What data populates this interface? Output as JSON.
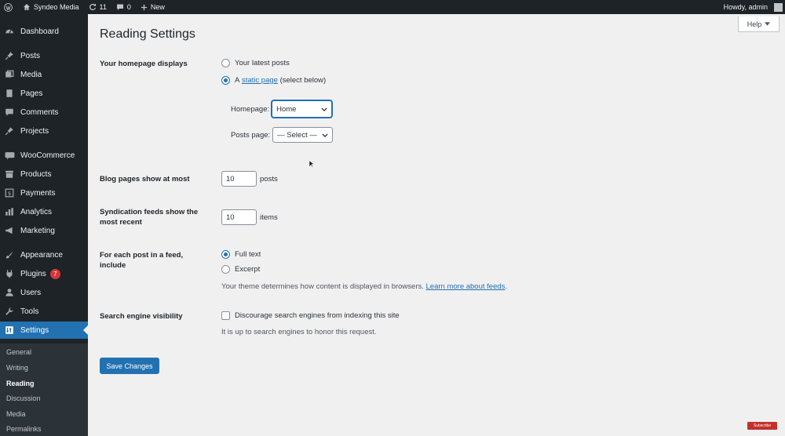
{
  "adminbar": {
    "site_name": "Syndeo Media",
    "updates_count": "11",
    "comments_count": "0",
    "new_label": "New",
    "howdy": "Howdy, admin"
  },
  "sidebar": {
    "items": [
      {
        "label": "Dashboard",
        "icon": "dashboard-icon"
      },
      {
        "label": "Posts",
        "icon": "pin-icon"
      },
      {
        "label": "Media",
        "icon": "media-icon"
      },
      {
        "label": "Pages",
        "icon": "page-icon"
      },
      {
        "label": "Comments",
        "icon": "comment-icon"
      },
      {
        "label": "Projects",
        "icon": "pin-icon"
      },
      {
        "label": "WooCommerce",
        "icon": "woo-icon"
      },
      {
        "label": "Products",
        "icon": "archive-icon"
      },
      {
        "label": "Payments",
        "icon": "dollar-icon"
      },
      {
        "label": "Analytics",
        "icon": "bar-chart-icon"
      },
      {
        "label": "Marketing",
        "icon": "megaphone-icon"
      },
      {
        "label": "Appearance",
        "icon": "brush-icon"
      },
      {
        "label": "Plugins",
        "icon": "plug-icon",
        "badge": "7"
      },
      {
        "label": "Users",
        "icon": "user-icon"
      },
      {
        "label": "Tools",
        "icon": "wrench-icon"
      },
      {
        "label": "Settings",
        "icon": "settings-icon"
      }
    ],
    "submenu": [
      "General",
      "Writing",
      "Reading",
      "Discussion",
      "Media",
      "Permalinks"
    ]
  },
  "help_label": "Help",
  "page_title": "Reading Settings",
  "homepage_displays": {
    "label": "Your homepage displays",
    "option_latest": "Your latest posts",
    "option_static_prefix": "A",
    "option_static_link": "static page",
    "option_static_suffix": "(select below)",
    "homepage_label": "Homepage:",
    "homepage_value": "Home",
    "posts_page_label": "Posts page:",
    "posts_page_value": "— Select —"
  },
  "blog_pages": {
    "label": "Blog pages show at most",
    "value": "10",
    "unit": "posts"
  },
  "syndication": {
    "label": "Syndication feeds show the most recent",
    "value": "10",
    "unit": "items"
  },
  "feed_content": {
    "label": "For each post in a feed, include",
    "option_full": "Full text",
    "option_excerpt": "Excerpt",
    "desc_prefix": "Your theme determines how content is displayed in browsers.",
    "desc_link": "Learn more about feeds"
  },
  "search_visibility": {
    "label": "Search engine visibility",
    "checkbox_label": "Discourage search engines from indexing this site",
    "desc": "It is up to search engines to honor this request."
  },
  "save_label": "Save Changes",
  "yt_badge": "Subscribe",
  "colors": {
    "accent": "#2271b1",
    "sidebar_bg": "#1d2327",
    "page_bg": "#f0f0f1",
    "badge": "#d63638"
  }
}
